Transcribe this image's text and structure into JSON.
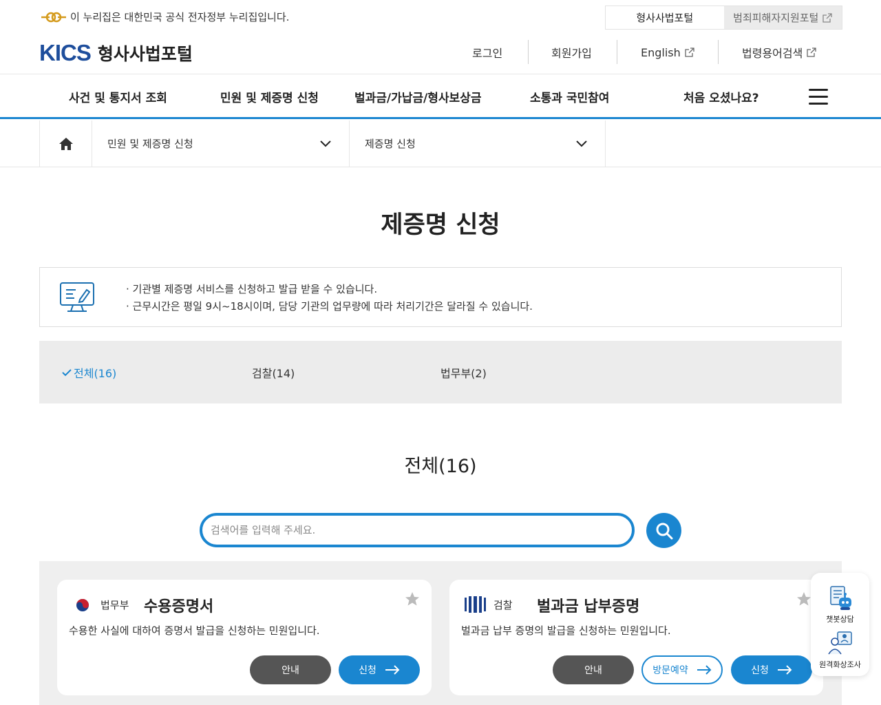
{
  "gov_bar": {
    "text": "이 누리집은 대한민국 공식 전자정부 누리집입니다.",
    "portal_tabs": [
      "형사사법포털",
      "범죄피해자지원포털"
    ]
  },
  "header": {
    "logo_mark": "KICS",
    "logo_name": "형사사법포털",
    "util_links": [
      "로그인",
      "회원가입",
      "English",
      "법령용어검색"
    ]
  },
  "gnb": {
    "items": [
      "사건 및 통지서 조회",
      "민원 및 제증명 신청",
      "벌과금/가납금/형사보상금",
      "소통과 국민참여",
      "처음 오셨나요?"
    ]
  },
  "breadcrumb": {
    "level1": "민원 및 제증명 신청",
    "level2": "제증명 신청"
  },
  "page": {
    "title": "제증명 신청",
    "info": [
      "· 기관별 제증명 서비스를 신청하고 발급 받을 수 있습니다.",
      "· 근무시간은 평일 9시~18시이며, 담당 기관의 업무량에 따라 처리기간은 달라질 수 있습니다."
    ]
  },
  "filters": [
    {
      "label": "전체(16)",
      "active": true
    },
    {
      "label": "검찰(14)",
      "active": false
    },
    {
      "label": "법무부(2)",
      "active": false
    }
  ],
  "section": {
    "title": "전체(16)"
  },
  "search": {
    "placeholder": "검색어를 입력해 주세요.",
    "value": ""
  },
  "cards": [
    {
      "org": "법무부",
      "title": "수용증명서",
      "desc": "수용한 사실에 대하여 증명서 발급을 신청하는 민원입니다.",
      "buttons": [
        "안내",
        "신청"
      ]
    },
    {
      "org": "검찰",
      "title": "벌과금 납부증명",
      "desc": "벌과금 납부 증명의 발급을 신청하는 민원입니다.",
      "buttons": [
        "안내",
        "방문예약",
        "신청"
      ]
    }
  ],
  "float_menu": {
    "items": [
      "챗봇상담",
      "원격화상조사"
    ]
  },
  "colors": {
    "accent": "#1a86d0",
    "brand": "#1e4e9c",
    "dark_button": "#555555"
  }
}
